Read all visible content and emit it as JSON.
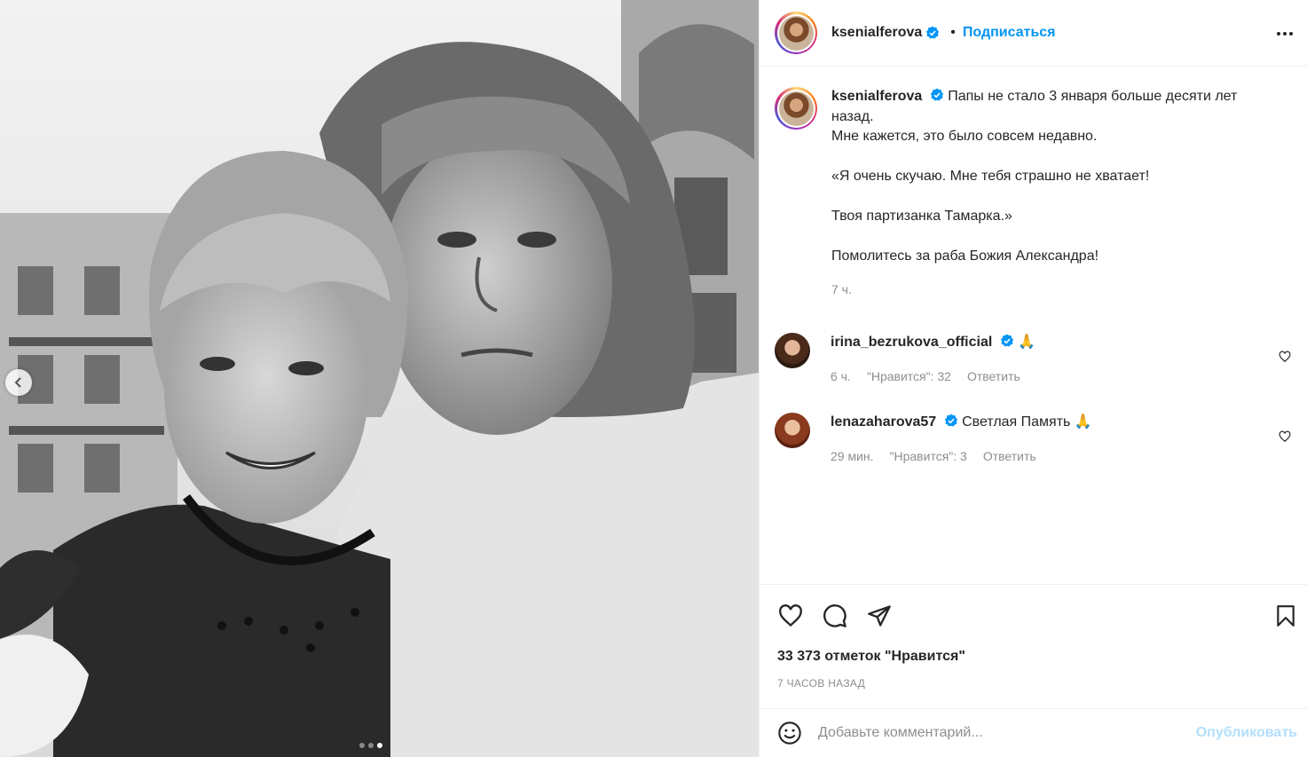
{
  "post": {
    "author": "ksenialferova",
    "follow_label": "Подписаться",
    "bullet": "•",
    "caption": {
      "lines": [
        "Папы не стало 3 января больше десяти лет",
        "назад.",
        "Мне кажется, это было совсем недавно.",
        "«Я очень скучаю. Мне тебя страшно не хватает!",
        "Твоя партизанка Тамарка.»",
        "Помолитесь за раба Божия Александра!"
      ],
      "time": "7 ч."
    },
    "comments": [
      {
        "username": "irina_bezrukova_official",
        "text": "🙏",
        "time": "6 ч.",
        "likes": "\"Нравится\": 32",
        "reply_label": "Ответить"
      },
      {
        "username": "lenazaharova57",
        "text": "Светлая Память 🙏",
        "time": "29 мин.",
        "likes": "\"Нравится\": 3",
        "reply_label": "Ответить"
      }
    ],
    "likes_count": "33 373 отметок \"Нравится\"",
    "time_ago": "7 ЧАСОВ НАЗАД",
    "comment_placeholder": "Добавьте комментарий...",
    "publish_label": "Опубликовать"
  },
  "carousel": {
    "count": 3,
    "active": 3
  },
  "icons": {
    "verified": "verified-badge-icon",
    "more": "more-options-icon",
    "like": "heart-icon",
    "comment": "comment-icon",
    "share": "share-icon",
    "save": "bookmark-icon",
    "emoji": "emoji-icon",
    "prev": "chevron-left-icon"
  },
  "colors": {
    "accent": "#0095f6",
    "verified": "#0095f6",
    "muted": "#8e8e8e",
    "publish_disabled": "#b2dffc"
  }
}
